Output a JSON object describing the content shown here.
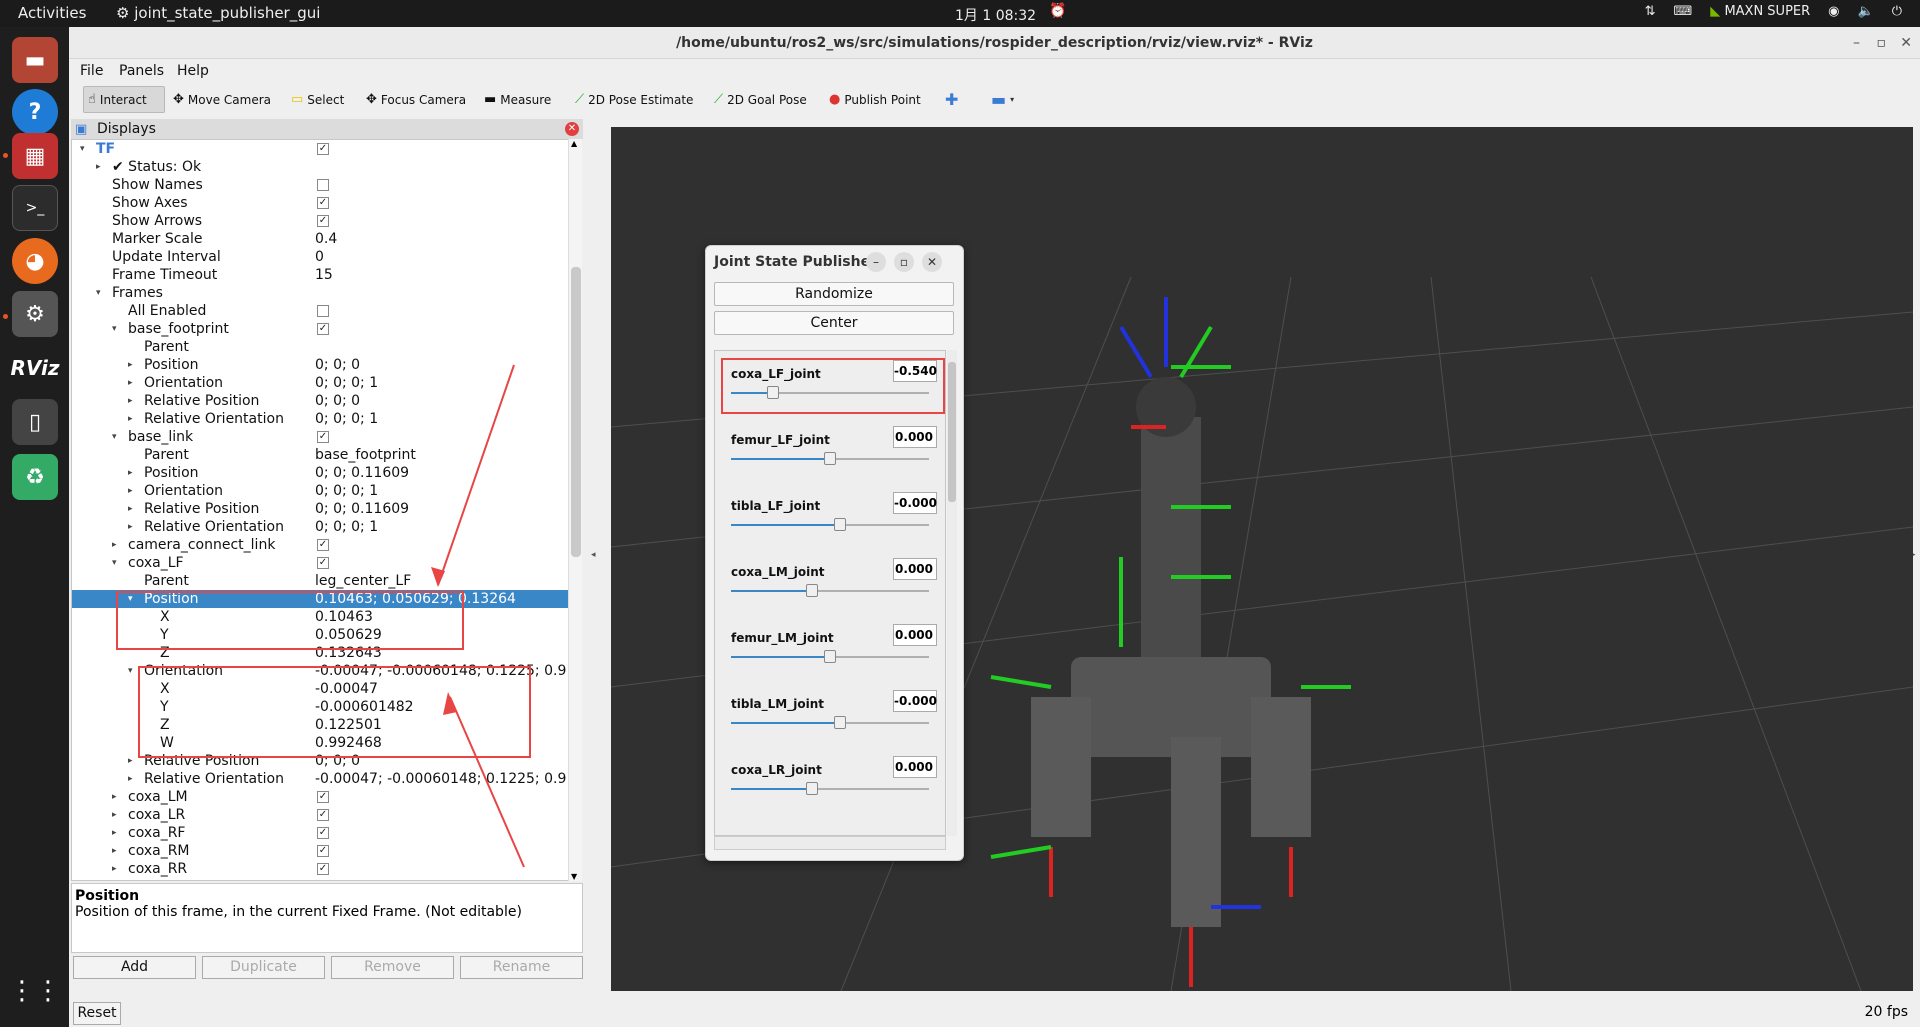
{
  "topbar": {
    "activities": "Activities",
    "app_name": "joint_state_publisher_gui",
    "clock": "1月 1  08:32",
    "gpu_mode": "MAXN SUPER"
  },
  "window": {
    "title": "/home/ubuntu/ros2_ws/src/simulations/rospider_description/rviz/view.rviz* - RViz"
  },
  "menu": [
    "File",
    "Panels",
    "Help"
  ],
  "toolbar": [
    "Interact",
    "Move Camera",
    "Select",
    "Focus Camera",
    "Measure",
    "2D Pose Estimate",
    "2D Goal Pose",
    "Publish Point"
  ],
  "displays": {
    "title": "Displays",
    "rows": [
      {
        "label": "TF",
        "value": "",
        "cb": true,
        "arrow": "▾"
      },
      {
        "label": "✔ Status: Ok",
        "value": "",
        "arrow": "▸"
      },
      {
        "label": "Show Names",
        "value": "",
        "cb": false
      },
      {
        "label": "Show Axes",
        "value": "",
        "cb": true
      },
      {
        "label": "Show Arrows",
        "value": "",
        "cb": true
      },
      {
        "label": "Marker Scale",
        "value": "0.4"
      },
      {
        "label": "Update Interval",
        "value": "0"
      },
      {
        "label": "Frame Timeout",
        "value": "15"
      },
      {
        "label": "Frames",
        "value": "",
        "arrow": "▾"
      },
      {
        "label": "All Enabled",
        "value": "",
        "cb": false
      },
      {
        "label": "base_footprint",
        "value": "",
        "cb": true,
        "arrow": "▾"
      },
      {
        "label": "Parent",
        "value": ""
      },
      {
        "label": "Position",
        "value": "0; 0; 0",
        "arrow": "▸"
      },
      {
        "label": "Orientation",
        "value": "0; 0; 0; 1",
        "arrow": "▸"
      },
      {
        "label": "Relative Position",
        "value": "0; 0; 0",
        "arrow": "▸"
      },
      {
        "label": "Relative Orientation",
        "value": "0; 0; 0; 1",
        "arrow": "▸"
      },
      {
        "label": "base_link",
        "value": "",
        "cb": true,
        "arrow": "▾"
      },
      {
        "label": "Parent",
        "value": "base_footprint"
      },
      {
        "label": "Position",
        "value": "0; 0; 0.11609",
        "arrow": "▸"
      },
      {
        "label": "Orientation",
        "value": "0; 0; 0; 1",
        "arrow": "▸"
      },
      {
        "label": "Relative Position",
        "value": "0; 0; 0.11609",
        "arrow": "▸"
      },
      {
        "label": "Relative Orientation",
        "value": "0; 0; 0; 1",
        "arrow": "▸"
      },
      {
        "label": "camera_connect_link",
        "value": "",
        "cb": true,
        "arrow": "▸"
      },
      {
        "label": "coxa_LF",
        "value": "",
        "cb": true,
        "arrow": "▾"
      },
      {
        "label": "Parent",
        "value": "leg_center_LF"
      },
      {
        "label": "Position",
        "value": "0.10463; 0.050629; 0.13264",
        "arrow": "▾",
        "sel": true
      },
      {
        "label": "X",
        "value": "0.10463"
      },
      {
        "label": "Y",
        "value": "0.050629"
      },
      {
        "label": "Z",
        "value": "0.132643"
      },
      {
        "label": "Orientation",
        "value": "-0.00047; -0.00060148; 0.1225; 0.9…",
        "arrow": "▾"
      },
      {
        "label": "X",
        "value": "-0.00047"
      },
      {
        "label": "Y",
        "value": "-0.000601482"
      },
      {
        "label": "Z",
        "value": "0.122501"
      },
      {
        "label": "W",
        "value": "0.992468"
      },
      {
        "label": "Relative Position",
        "value": "0; 0; 0",
        "arrow": "▸"
      },
      {
        "label": "Relative Orientation",
        "value": "-0.00047; -0.00060148; 0.1225; 0.9…",
        "arrow": "▸"
      },
      {
        "label": "coxa_LM",
        "value": "",
        "cb": true,
        "arrow": "▸"
      },
      {
        "label": "coxa_LR",
        "value": "",
        "cb": true,
        "arrow": "▸"
      },
      {
        "label": "coxa_RF",
        "value": "",
        "cb": true,
        "arrow": "▸"
      },
      {
        "label": "coxa_RM",
        "value": "",
        "cb": true,
        "arrow": "▸"
      },
      {
        "label": "coxa_RR",
        "value": "",
        "cb": true,
        "arrow": "▸"
      }
    ]
  },
  "description": {
    "title": "Position",
    "text": "Position of this frame, in the current Fixed Frame. (Not editable)"
  },
  "panel_buttons": {
    "add": "Add",
    "duplicate": "Duplicate",
    "remove": "Remove",
    "rename": "Rename",
    "reset": "Reset"
  },
  "jsp": {
    "title": "Joint State Publisher",
    "randomize": "Randomize",
    "center": "Center",
    "joints": [
      {
        "name": "coxa_LF_joint",
        "value": "-0.540",
        "fraction": 0.21
      },
      {
        "name": "femur_LF_joint",
        "value": "0.000",
        "fraction": 0.5
      },
      {
        "name": "tibla_LF_joint",
        "value": "-0.000",
        "fraction": 0.55
      },
      {
        "name": "coxa_LM_joint",
        "value": "0.000",
        "fraction": 0.41
      },
      {
        "name": "femur_LM_joint",
        "value": "0.000",
        "fraction": 0.5
      },
      {
        "name": "tibla_LM_joint",
        "value": "-0.000",
        "fraction": 0.55
      },
      {
        "name": "coxa_LR_joint",
        "value": "0.000",
        "fraction": 0.41
      }
    ]
  },
  "status": {
    "fps": "20 fps"
  }
}
